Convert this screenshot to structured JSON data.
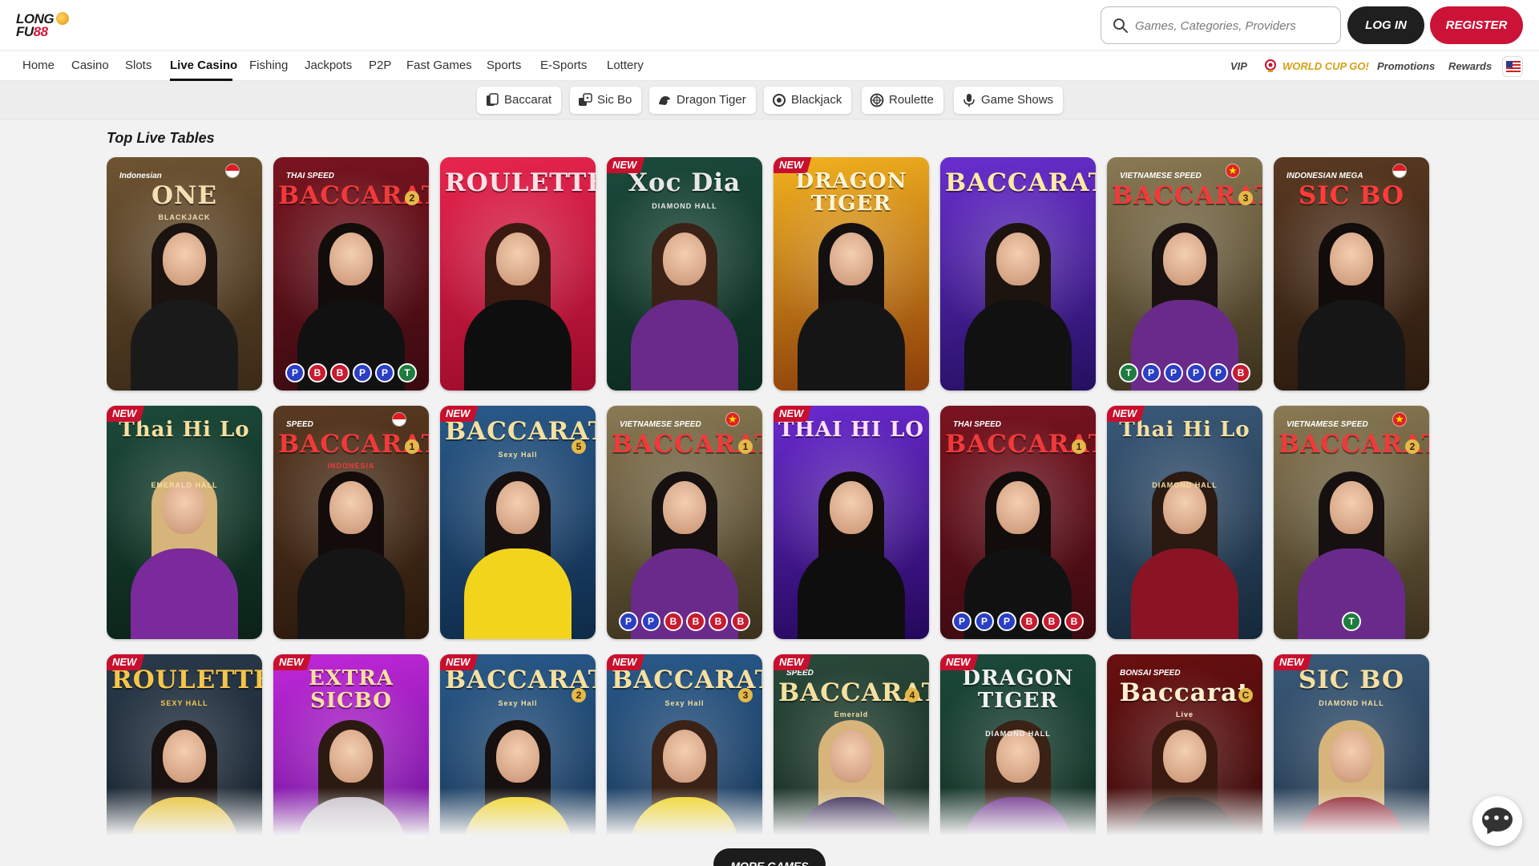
{
  "header": {
    "logo_line1": "LONG",
    "logo_line2a": "FU",
    "logo_line2b": "88",
    "search_placeholder": "Games, Categories, Providers",
    "login_label": "LOG IN",
    "register_label": "REGISTER"
  },
  "nav": {
    "items": [
      "Home",
      "Casino",
      "Slots",
      "Live Casino",
      "Fishing",
      "Jackpots",
      "P2P",
      "Fast Games",
      "Sports",
      "E-Sports",
      "Lottery"
    ],
    "active": "Live Casino",
    "right": {
      "vip": "VIP",
      "world_cup": "WORLD CUP GO!",
      "promotions": "Promotions",
      "rewards": "Rewards"
    }
  },
  "categories": [
    {
      "label": "Baccarat",
      "icon": "baccarat-cards-icon"
    },
    {
      "label": "Sic Bo",
      "icon": "dice-icon"
    },
    {
      "label": "Dragon Tiger",
      "icon": "dragon-icon"
    },
    {
      "label": "Blackjack",
      "icon": "blackjack-icon"
    },
    {
      "label": "Roulette",
      "icon": "roulette-icon"
    },
    {
      "label": "Game Shows",
      "icon": "microphone-icon"
    }
  ],
  "section_title": "Top Live Tables",
  "colors": {
    "brand_red": "#cc1236",
    "dark": "#1f1f1f",
    "world_cup_gold": "#d4a017"
  },
  "rows": [
    [
      {
        "pre": "Indonesian",
        "title": "ONE",
        "sub": "BLACKJACK",
        "new": false,
        "flag": "id",
        "num": "",
        "pills": [],
        "bg": [
          "#6e5432",
          "#3b2a17"
        ],
        "titleColor": "#f3dfb2",
        "dress": "#1a1a1a",
        "hair": "#1a1310"
      },
      {
        "pre": "THAI SPEED",
        "title": "BACCARAT",
        "sub": "",
        "new": false,
        "flag": "",
        "num": "2",
        "pills": [
          "P",
          "B",
          "B",
          "P",
          "P",
          "T"
        ],
        "bg": [
          "#7a1420",
          "#3a0a10"
        ],
        "titleColor": "#f03a3a",
        "dress": "#111111",
        "hair": "#120c0a"
      },
      {
        "pre": "",
        "title": "ROULETTE",
        "sub": "",
        "new": false,
        "flag": "",
        "num": "",
        "pills": [],
        "bg": [
          "#e8254e",
          "#9a0b2b"
        ],
        "titleColor": "#ffe1e6",
        "dress": "#0e0e0e",
        "hair": "#3a1a10"
      },
      {
        "pre": "",
        "title": "Xoc Dia",
        "sub": "DIAMOND HALL",
        "new": true,
        "flag": "",
        "num": "",
        "pills": [],
        "bg": [
          "#1b4a3b",
          "#0c2a20"
        ],
        "titleColor": "#e8e8e8",
        "dress": "#6a2a8a",
        "hair": "#3a2216"
      },
      {
        "pre": "",
        "title": "DRAGON TIGER",
        "sub": "",
        "new": true,
        "flag": "",
        "num": "",
        "pills": [],
        "bg": [
          "#f3b21f",
          "#8a3d0b"
        ],
        "titleColor": "#fff5d8",
        "dress": "#151515",
        "hair": "#141010"
      },
      {
        "pre": "",
        "title": "BACCARAT",
        "sub": "",
        "new": false,
        "flag": "",
        "num": "",
        "pills": [],
        "bg": [
          "#6a2fd0",
          "#241060"
        ],
        "titleColor": "#ffe9a8",
        "dress": "#111111",
        "hair": "#1d1410"
      },
      {
        "pre": "VIETNAMESE SPEED",
        "title": "BACCARAT",
        "sub": "",
        "new": false,
        "flag": "vn",
        "num": "3",
        "pills": [
          "T",
          "P",
          "P",
          "P",
          "P",
          "B"
        ],
        "bg": [
          "#8a7a54",
          "#3a301c"
        ],
        "titleColor": "#f03a3a",
        "dress": "#6a2a8a",
        "hair": "#1a1210"
      },
      {
        "pre": "INDONESIAN MEGA",
        "title": "SIC BO",
        "sub": "",
        "new": false,
        "flag": "id",
        "num": "",
        "pills": [],
        "bg": [
          "#5a3a22",
          "#2a1a0e"
        ],
        "titleColor": "#ff3b3b",
        "dress": "#161616",
        "hair": "#120c0a"
      }
    ],
    [
      {
        "pre": "",
        "title": "Thai Hi Lo",
        "sub": "EMERALD HALL",
        "new": true,
        "flag": "",
        "num": "",
        "pills": [],
        "bg": [
          "#1c4a3a",
          "#0b2218"
        ],
        "titleColor": "#f5dfa0",
        "dress": "#7a2a9a",
        "hair": "#d6b47a"
      },
      {
        "pre": "SPEED",
        "title": "BACCARAT",
        "sub": "INDONESIA",
        "new": false,
        "flag": "id",
        "num": "1",
        "pills": [],
        "bg": [
          "#5a3a22",
          "#2a180c"
        ],
        "titleColor": "#f03a3a",
        "dress": "#151515",
        "hair": "#140c0a"
      },
      {
        "pre": "",
        "title": "BACCARAT",
        "sub": "Sexy Hall",
        "new": true,
        "flag": "",
        "num": "5",
        "pills": [],
        "bg": [
          "#2a5a8a",
          "#0e2a48"
        ],
        "titleColor": "#f5e0a0",
        "dress": "#f2d41c",
        "hair": "#161010"
      },
      {
        "pre": "VIETNAMESE SPEED",
        "title": "BACCARAT",
        "sub": "",
        "new": false,
        "flag": "vn",
        "num": "1",
        "pills": [
          "P",
          "P",
          "B",
          "B",
          "B",
          "B"
        ],
        "bg": [
          "#8a7a54",
          "#3a301c"
        ],
        "titleColor": "#f03a3a",
        "dress": "#6a2a8a",
        "hair": "#161010"
      },
      {
        "pre": "",
        "title": "THAI HI LO",
        "sub": "",
        "new": true,
        "flag": "",
        "num": "",
        "pills": [],
        "bg": [
          "#6a2ad0",
          "#24085a"
        ],
        "titleColor": "#ffe1ff",
        "dress": "#0e0e0e",
        "hair": "#120c0a"
      },
      {
        "pre": "THAI SPEED",
        "title": "BACCARAT",
        "sub": "",
        "new": false,
        "flag": "",
        "num": "1",
        "pills": [
          "P",
          "P",
          "P",
          "B",
          "B",
          "B"
        ],
        "bg": [
          "#7a1420",
          "#3a0a10"
        ],
        "titleColor": "#f03a3a",
        "dress": "#111111",
        "hair": "#120c0a"
      },
      {
        "pre": "",
        "title": "Thai Hi Lo",
        "sub": "DIAMOND HALL",
        "new": true,
        "flag": "",
        "num": "",
        "pills": [],
        "bg": [
          "#3a5a7a",
          "#16283a"
        ],
        "titleColor": "#f5dfa0",
        "dress": "#8a1424",
        "hair": "#2a1a12"
      },
      {
        "pre": "VIETNAMESE SPEED",
        "title": "BACCARAT",
        "sub": "",
        "new": false,
        "flag": "vn",
        "num": "2",
        "pills": [
          "T"
        ],
        "bg": [
          "#8a7a54",
          "#3a301c"
        ],
        "titleColor": "#f03a3a",
        "dress": "#6a2a8a",
        "hair": "#161010"
      }
    ],
    [
      {
        "pre": "",
        "title": "ROULETTE",
        "sub": "SEXY HALL",
        "new": true,
        "flag": "",
        "num": "",
        "pills": [],
        "bg": [
          "#2a3a4a",
          "#0e1822"
        ],
        "titleColor": "#f5c64a",
        "dress": "#e8c22c",
        "hair": "#1a1210"
      },
      {
        "pre": "",
        "title": "EXTRA SICBO",
        "sub": "",
        "new": true,
        "flag": "",
        "num": "",
        "pills": [],
        "bg": [
          "#c028d8",
          "#5a0a8a"
        ],
        "titleColor": "#ffe0a0",
        "dress": "#c8c0c8",
        "hair": "#2a1a12"
      },
      {
        "pre": "",
        "title": "BACCARAT",
        "sub": "Sexy Hall",
        "new": true,
        "flag": "",
        "num": "2",
        "pills": [],
        "bg": [
          "#2a5a8a",
          "#0e2a48"
        ],
        "titleColor": "#f5e0a0",
        "dress": "#f2d41c",
        "hair": "#161010"
      },
      {
        "pre": "",
        "title": "BACCARAT",
        "sub": "Sexy Hall",
        "new": true,
        "flag": "",
        "num": "3",
        "pills": [],
        "bg": [
          "#2a5a8a",
          "#0e2a48"
        ],
        "titleColor": "#f5e0a0",
        "dress": "#f2d41c",
        "hair": "#3a2216"
      },
      {
        "pre": "SPEED",
        "title": "BACCARAT",
        "sub": "Emerald",
        "new": true,
        "flag": "",
        "num": "4",
        "pills": [],
        "bg": [
          "#2a4a3a",
          "#0e2018"
        ],
        "titleColor": "#f5e0a0",
        "dress": "#2a1a4a",
        "hair": "#d6b47a"
      },
      {
        "pre": "",
        "title": "DRAGON TIGER",
        "sub": "DIAMOND HALL",
        "new": true,
        "flag": "",
        "num": "",
        "pills": [],
        "bg": [
          "#1c4a3a",
          "#0b2218"
        ],
        "titleColor": "#f2f2f2",
        "dress": "#6a2a8a",
        "hair": "#3a2216"
      },
      {
        "pre": "BONSAI SPEED",
        "title": "Baccarat",
        "sub": "Live",
        "new": false,
        "flag": "",
        "num": "C",
        "pills": [],
        "bg": [
          "#6a1010",
          "#2a0606"
        ],
        "titleColor": "#fff1d0",
        "dress": "#1a1010",
        "hair": "#3a1a10"
      },
      {
        "pre": "",
        "title": "SIC BO",
        "sub": "DIAMOND HALL",
        "new": true,
        "flag": "",
        "num": "",
        "pills": [],
        "bg": [
          "#3a5a7a",
          "#16283a"
        ],
        "titleColor": "#f5dfa0",
        "dress": "#8a1424",
        "hair": "#d6b47a"
      }
    ]
  ],
  "more_games_label": "MORE GAMES"
}
